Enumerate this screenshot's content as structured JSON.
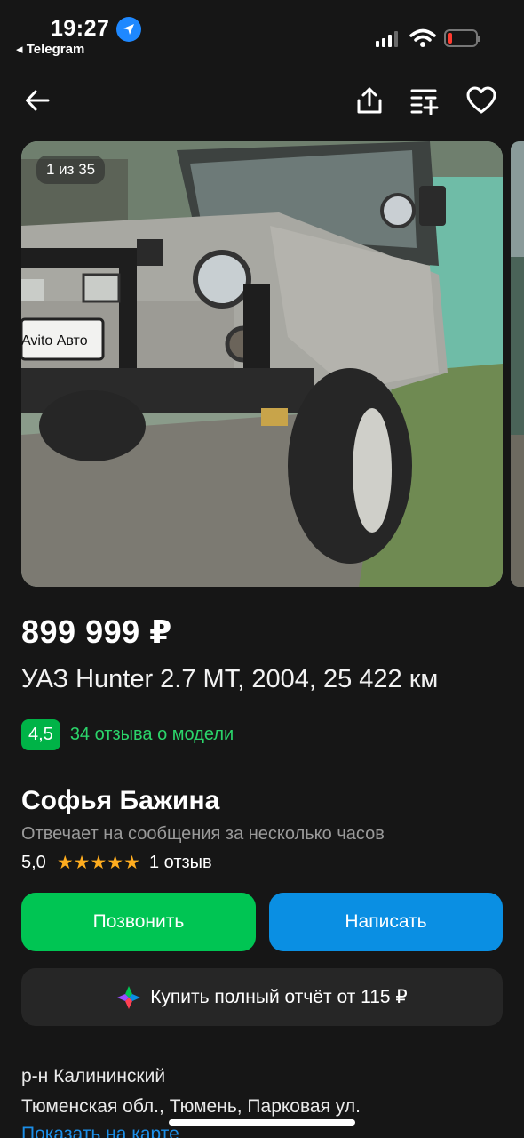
{
  "status_bar": {
    "time": "19:27",
    "back_app": "◂ Telegram",
    "signal_bars": 4,
    "signal_active": 3,
    "battery_level": 0.08
  },
  "toolbar": {
    "back_icon": "arrow-left-icon",
    "share_icon": "share-icon",
    "compare_icon": "compare-add-icon",
    "favorite_icon": "heart-icon"
  },
  "gallery": {
    "counter": "1 из 35",
    "plate_text": "Avito Авто"
  },
  "listing": {
    "price": "899 999 ₽",
    "title": "УАЗ Hunter 2.7 MT, 2004, 25 422 км",
    "model_rating": "4,5",
    "model_reviews": "34 отзыва о модели"
  },
  "seller": {
    "name": "Софья Бажина",
    "reply_time": "Отвечает на сообщения за несколько часов",
    "rating": "5,0",
    "stars": "★★★★★",
    "reviews": "1 отзыв"
  },
  "actions": {
    "call_label": "Позвонить",
    "message_label": "Написать",
    "report_label": "Купить полный отчёт от 115 ₽"
  },
  "address": {
    "district": "р-н Калининский",
    "full": "Тюменская обл., Тюмень, Парковая ул.",
    "map_link": "Показать на карте"
  },
  "colors": {
    "background": "#161616",
    "accent_green": "#00c553",
    "accent_blue": "#0a8fe3",
    "rating_green": "#00b347",
    "link_blue": "#1c8fe8",
    "star": "#ffad1f"
  }
}
